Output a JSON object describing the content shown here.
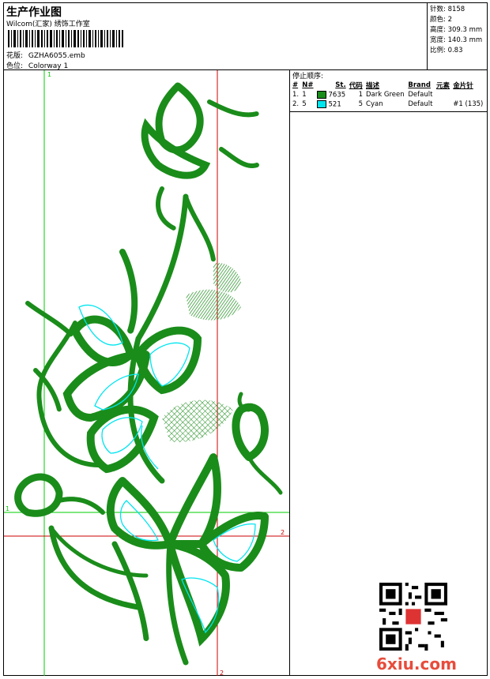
{
  "header": {
    "title": "生产作业图",
    "subtitle": "Wilcom(汇家) 绣饰工作室",
    "design_label": "花版:",
    "design_value": "GZHA6055.emb",
    "colorway_label": "色位:",
    "colorway_value": "Colorway 1"
  },
  "stats": {
    "stitches": "针数: 8158",
    "colors": "颜色: 2",
    "height": "高度: 309.3 mm",
    "width": "宽度: 140.3 mm",
    "scale": "比例: 0.83"
  },
  "stop_sequence": {
    "title": "停止顺序:",
    "columns": [
      "#",
      "N#",
      "St.",
      "代码",
      "描述",
      "Brand",
      "元素",
      "金片针"
    ],
    "rows": [
      {
        "num": "1.",
        "needle": "1",
        "color": "#1a8c1a",
        "stitches": "7635",
        "code": "1",
        "desc": "Dark Green",
        "brand": "Default",
        "elem": "",
        "sequin": ""
      },
      {
        "num": "2.",
        "needle": "5",
        "color": "#00e5ee",
        "stitches": "521",
        "code": "5",
        "desc": "Cyan",
        "brand": "Default",
        "elem": "",
        "sequin": "#1 (135)"
      }
    ]
  },
  "canvas": {
    "guide_labels": {
      "v1": "1",
      "h1": "1",
      "h2": "2",
      "v2": "2"
    },
    "guide_colors": {
      "green": "#00cc00",
      "red": "#cc0000"
    },
    "thread_colors": {
      "green": "#1a8c1a",
      "cyan": "#00e5ee"
    }
  },
  "watermark": {
    "text": "6xiu.com"
  }
}
